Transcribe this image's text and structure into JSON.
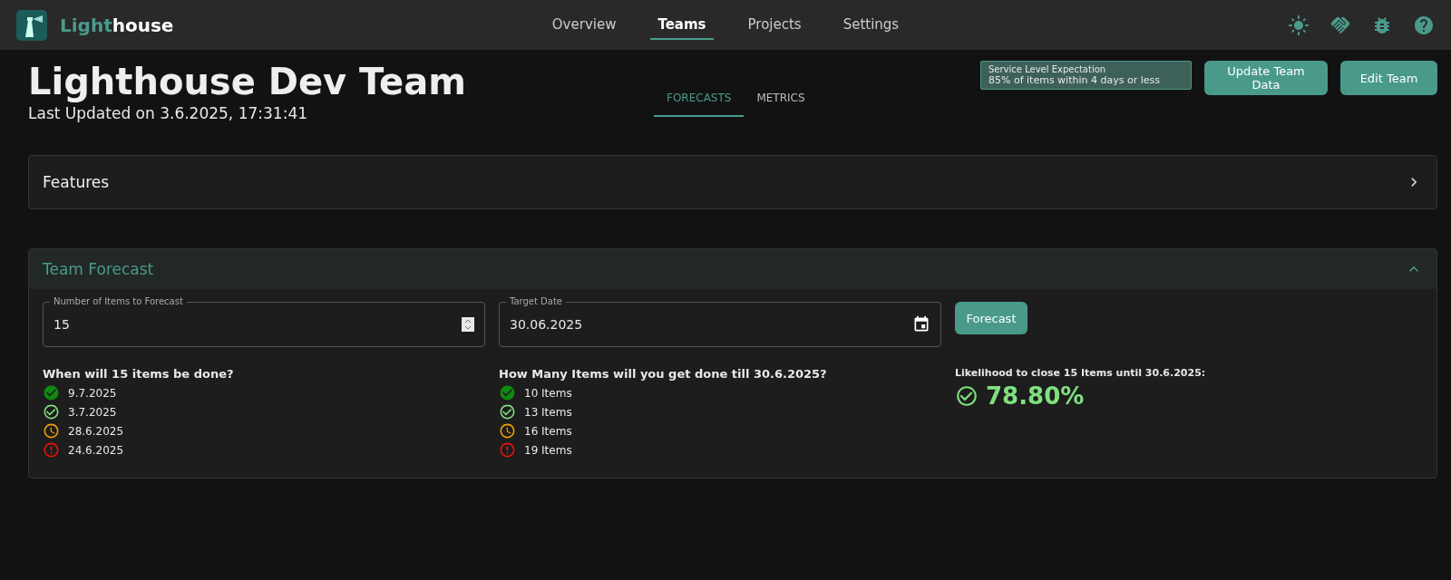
{
  "brand": {
    "accent": "Light",
    "rest": "house"
  },
  "nav": [
    {
      "label": "Overview",
      "selected": false
    },
    {
      "label": "Teams",
      "selected": true
    },
    {
      "label": "Projects",
      "selected": false
    },
    {
      "label": "Settings",
      "selected": false
    }
  ],
  "page": {
    "title": "Lighthouse Dev Team",
    "subtitle": "Last Updated on 3.6.2025, 17:31:41"
  },
  "tabs": [
    {
      "label": "FORECASTS",
      "selected": true
    },
    {
      "label": "METRICS",
      "selected": false
    }
  ],
  "sle": {
    "label": "Service Level Expectation",
    "value": "85% of items within 4 days or less"
  },
  "buttons": [
    "Update Team Data",
    "Edit Team"
  ],
  "features": {
    "title": "Features",
    "expanded": false
  },
  "forecast": {
    "title": "Team Forecast",
    "expanded": true,
    "items_field": {
      "label": "Number of Items to Forecast",
      "value": "15"
    },
    "date_field": {
      "label": "Target Date",
      "value": "30.06.2025"
    },
    "button": "Forecast",
    "when": {
      "heading": "When will 15 items be done?",
      "results": [
        {
          "kind": "certain",
          "text": "9.7.2025"
        },
        {
          "kind": "likely",
          "text": "3.7.2025"
        },
        {
          "kind": "risky",
          "text": "28.6.2025"
        },
        {
          "kind": "unlikely",
          "text": "24.6.2025"
        }
      ]
    },
    "how_many": {
      "heading": "How Many Items will you get done till 30.6.2025?",
      "results": [
        {
          "kind": "certain",
          "text": "10 Items"
        },
        {
          "kind": "likely",
          "text": "13 Items"
        },
        {
          "kind": "risky",
          "text": "16 Items"
        },
        {
          "kind": "unlikely",
          "text": "19 Items"
        }
      ]
    },
    "likelihood": {
      "heading": "Likelihood to close 15 Items until 30.6.2025:",
      "kind": "likely",
      "value": "78.80%"
    }
  }
}
